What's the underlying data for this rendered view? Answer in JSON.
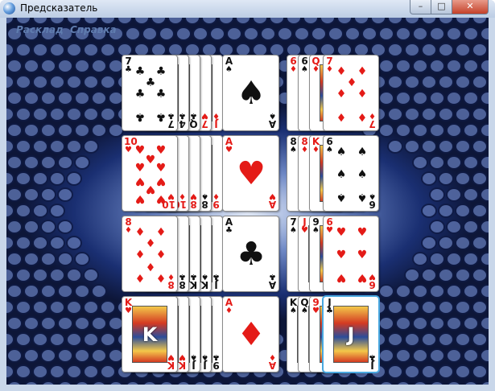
{
  "window": {
    "title": "Предсказатель"
  },
  "menu": {
    "items": [
      "Расклад",
      "Справка"
    ]
  },
  "colors": {
    "red": "#e41b17",
    "black": "#111111",
    "selection": "#49a8e0"
  },
  "rows": [
    {
      "main_card": {
        "rank": "7",
        "suit": "♣",
        "color": "black"
      },
      "hidden_left": [
        {
          "rank": "4",
          "suit": "♣",
          "color": "black"
        },
        {
          "rank": "Q",
          "suit": "♣",
          "color": "black"
        },
        {
          "rank": "7",
          "suit": "♥",
          "color": "red"
        },
        {
          "rank": "J",
          "suit": "♦",
          "color": "red"
        }
      ],
      "center_card": {
        "rank": "A",
        "suit": "♠",
        "color": "black"
      },
      "hidden_right": [
        {
          "rank": "6",
          "suit": "♦",
          "color": "red"
        },
        {
          "rank": "6",
          "suit": "♠",
          "color": "black"
        },
        {
          "rank": "Q",
          "suit": "♦",
          "color": "red"
        }
      ],
      "right_card": {
        "rank": "7",
        "suit": "♦",
        "color": "red",
        "selected": false
      }
    },
    {
      "main_card": {
        "rank": "10",
        "suit": "♥",
        "color": "red"
      },
      "hidden_left": [
        {
          "rank": "10",
          "suit": "♦",
          "color": "red"
        },
        {
          "rank": "8",
          "suit": "♥",
          "color": "red"
        },
        {
          "rank": "8",
          "suit": "♠",
          "color": "black"
        },
        {
          "rank": "9",
          "suit": "♦",
          "color": "red"
        }
      ],
      "center_card": {
        "rank": "A",
        "suit": "♥",
        "color": "red"
      },
      "hidden_right": [
        {
          "rank": "8",
          "suit": "♠",
          "color": "black"
        },
        {
          "rank": "8",
          "suit": "♦",
          "color": "red"
        },
        {
          "rank": "K",
          "suit": "♦",
          "color": "red"
        }
      ],
      "right_card": {
        "rank": "6",
        "suit": "♠",
        "color": "black",
        "selected": false
      }
    },
    {
      "main_card": {
        "rank": "8",
        "suit": "♦",
        "color": "red"
      },
      "hidden_left": [
        {
          "rank": "8",
          "suit": "♣",
          "color": "black"
        },
        {
          "rank": "K",
          "suit": "♣",
          "color": "black"
        },
        {
          "rank": "K",
          "suit": "♠",
          "color": "black"
        },
        {
          "rank": "J",
          "suit": "♣",
          "color": "black"
        }
      ],
      "center_card": {
        "rank": "A",
        "suit": "♣",
        "color": "black"
      },
      "hidden_right": [
        {
          "rank": "7",
          "suit": "♠",
          "color": "black"
        },
        {
          "rank": "J",
          "suit": "♥",
          "color": "red"
        },
        {
          "rank": "9",
          "suit": "♠",
          "color": "black"
        }
      ],
      "right_card": {
        "rank": "6",
        "suit": "♥",
        "color": "red",
        "selected": false
      }
    },
    {
      "main_card": {
        "rank": "K",
        "suit": "♥",
        "color": "red"
      },
      "hidden_left": [
        {
          "rank": "K",
          "suit": "♥",
          "color": "red"
        },
        {
          "rank": "J",
          "suit": "♠",
          "color": "black"
        },
        {
          "rank": "J",
          "suit": "♠",
          "color": "black"
        },
        {
          "rank": "9",
          "suit": "♣",
          "color": "black"
        }
      ],
      "center_card": {
        "rank": "A",
        "suit": "♦",
        "color": "red"
      },
      "hidden_right": [
        {
          "rank": "K",
          "suit": "♠",
          "color": "black"
        },
        {
          "rank": "Q",
          "suit": "♠",
          "color": "black"
        },
        {
          "rank": "9",
          "suit": "♥",
          "color": "red"
        }
      ],
      "right_card": {
        "rank": "J",
        "suit": "♣",
        "color": "black",
        "selected": true
      }
    }
  ]
}
